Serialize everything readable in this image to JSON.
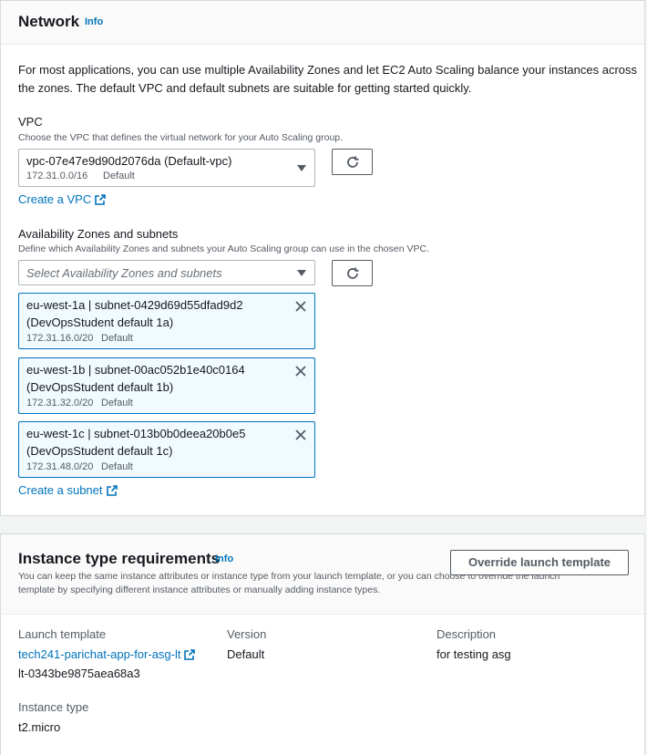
{
  "network": {
    "title": "Network",
    "info": "Info",
    "description": "For most applications, you can use multiple Availability Zones and let EC2 Auto Scaling balance your instances across the zones. The default VPC and default subnets are suitable for getting started quickly.",
    "vpc": {
      "label": "VPC",
      "description": "Choose the VPC that defines the virtual network for your Auto Scaling group.",
      "selected": "vpc-07e47e9d90d2076da (Default-vpc)",
      "cidr": "172.31.0.0/16",
      "tag": "Default",
      "create_link": "Create a VPC"
    },
    "azs": {
      "label": "Availability Zones and subnets",
      "description": "Define which Availability Zones and subnets your Auto Scaling group can use in the chosen VPC.",
      "placeholder": "Select Availability Zones and subnets",
      "tokens": [
        {
          "line1": "eu-west-1a | subnet-0429d69d55dfad9d2",
          "line2": "(DevOpsStudent default 1a)",
          "cidr": "172.31.16.0/20",
          "tag": "Default"
        },
        {
          "line1": "eu-west-1b | subnet-00ac052b1e40c0164",
          "line2": "(DevOpsStudent default 1b)",
          "cidr": "172.31.32.0/20",
          "tag": "Default"
        },
        {
          "line1": "eu-west-1c | subnet-013b0b0deea20b0e5",
          "line2": "(DevOpsStudent default 1c)",
          "cidr": "172.31.48.0/20",
          "tag": "Default"
        }
      ],
      "create_link": "Create a subnet"
    }
  },
  "itr": {
    "title": "Instance type requirements",
    "info": "Info",
    "description": "You can keep the same instance attributes or instance type from your launch template, or you can choose to override the launch template by specifying different instance attributes or manually adding instance types.",
    "override_button": "Override launch template",
    "launch_template_label": "Launch template",
    "launch_template_name": "tech241-parichat-app-for-asg-lt",
    "launch_template_id": "lt-0343be9875aea68a3",
    "version_label": "Version",
    "version_value": "Default",
    "description_label": "Description",
    "description_value": "for testing asg",
    "instance_type_label": "Instance type",
    "instance_type_value": "t2.micro"
  },
  "colors": {
    "link": "#0073bb",
    "token_bg": "#f1faff",
    "text": "#16191f",
    "muted": "#545b64"
  },
  "icons": [
    "external-link-icon",
    "refresh-icon",
    "caret-down-icon",
    "close-icon"
  ]
}
